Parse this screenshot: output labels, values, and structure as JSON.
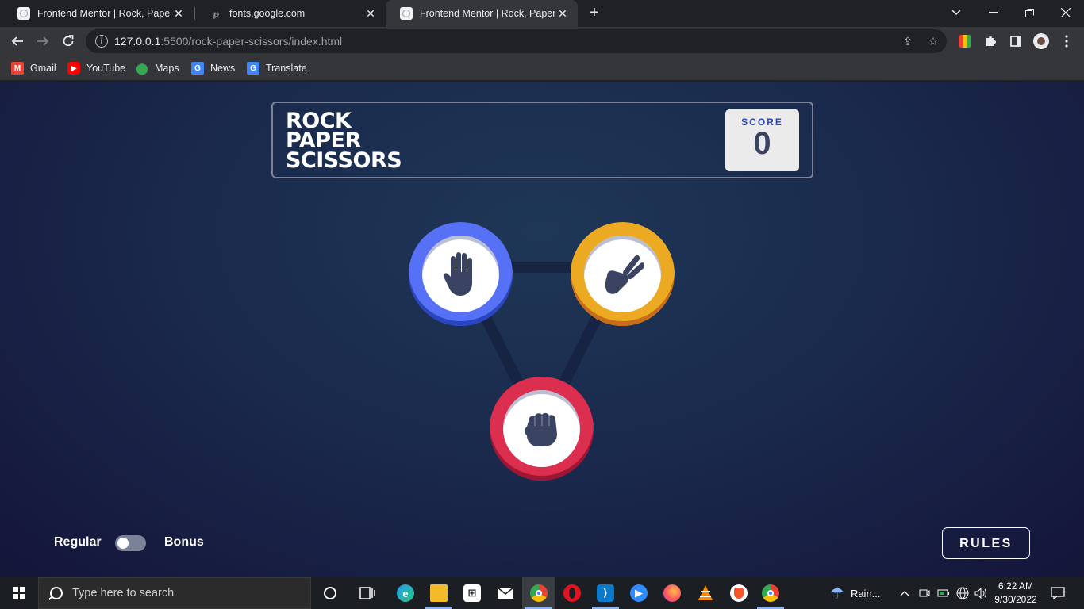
{
  "browser": {
    "tabs": [
      {
        "title": "Frontend Mentor | Rock, Paper, S",
        "favicon": "frontend-mentor-icon",
        "active": false
      },
      {
        "title": "fonts.google.com",
        "favicon": "google-fonts-icon",
        "active": false
      },
      {
        "title": "Frontend Mentor | Rock, Paper, S",
        "favicon": "frontend-mentor-icon",
        "active": true
      }
    ],
    "url_host": "127.0.0.1",
    "url_rest": ":5500/rock-paper-scissors/index.html",
    "bookmarks": [
      {
        "label": "Gmail",
        "icon": "gmail-icon",
        "color": "#ea4335"
      },
      {
        "label": "YouTube",
        "icon": "youtube-icon",
        "color": "#ff0000"
      },
      {
        "label": "Maps",
        "icon": "maps-icon",
        "color": "#34a853"
      },
      {
        "label": "News",
        "icon": "news-icon",
        "color": "#4285f4"
      },
      {
        "label": "Translate",
        "icon": "translate-icon",
        "color": "#4285f4"
      }
    ]
  },
  "game": {
    "logo_lines": [
      "ROCK",
      "PAPER",
      "SCISSORS"
    ],
    "score_label": "SCORE",
    "score_value": "0",
    "choices": [
      {
        "name": "paper",
        "icon": "hand-paper-icon",
        "ring_color": "#5671f5"
      },
      {
        "name": "scissors",
        "icon": "hand-scissors-icon",
        "ring_color": "#eca922"
      },
      {
        "name": "rock",
        "icon": "hand-rock-icon",
        "ring_color": "#dc2e4e"
      }
    ],
    "mode_regular": "Regular",
    "mode_bonus": "Bonus",
    "bonus_enabled": false,
    "rules_label": "RULES"
  },
  "taskbar": {
    "search_placeholder": "Type here to search",
    "weather": "Rain...",
    "time": "6:22 AM",
    "date": "9/30/2022",
    "apps": [
      "cortana-icon",
      "task-view-icon",
      "edge-icon",
      "file-explorer-icon",
      "store-icon",
      "mail-icon",
      "chrome-icon",
      "opera-icon",
      "vscode-icon",
      "zoom-icon",
      "firefox-icon",
      "vlc-icon",
      "brave-icon",
      "chrome-icon"
    ]
  }
}
